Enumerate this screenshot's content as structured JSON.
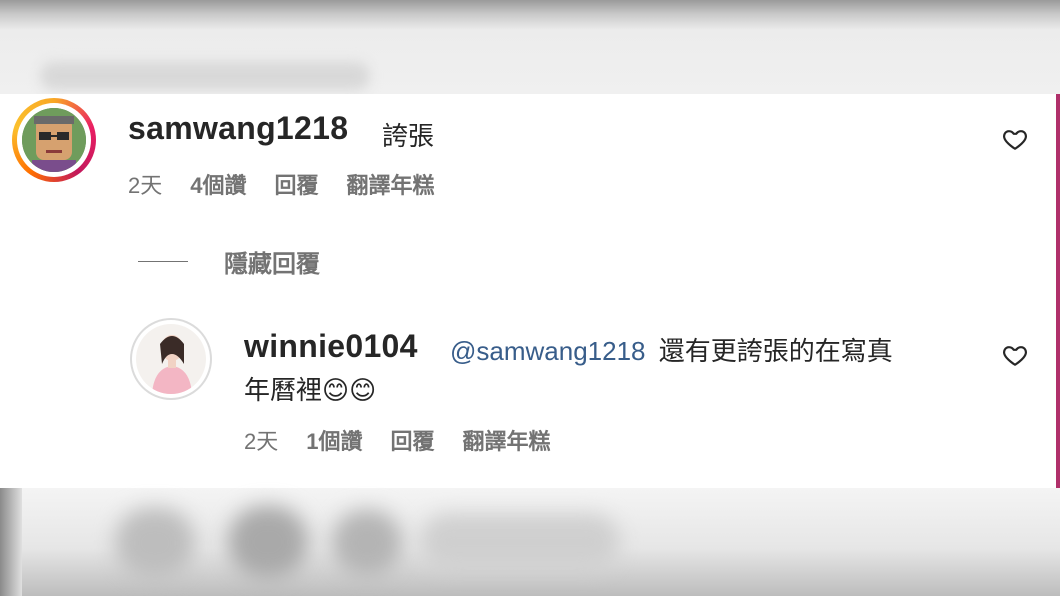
{
  "comment": {
    "username": "samwang1218",
    "text": "誇張",
    "time": "2天",
    "likes": "4個讚",
    "reply_label": "回覆",
    "translate_label": "翻譯年糕"
  },
  "thread": {
    "hide_replies_label": "隱藏回覆"
  },
  "reply": {
    "username": "winnie0104",
    "mention": "@samwang1218",
    "text_line1": "還有更誇張的在寫真",
    "text_line2": "年曆裡😊😊",
    "time": "2天",
    "likes": "1個讚",
    "reply_label": "回覆",
    "translate_label": "翻譯年糕"
  },
  "icons": {
    "like": "heart-outline-icon"
  },
  "colors": {
    "mention": "#385d8a",
    "meta": "#737373",
    "text": "#262626"
  }
}
